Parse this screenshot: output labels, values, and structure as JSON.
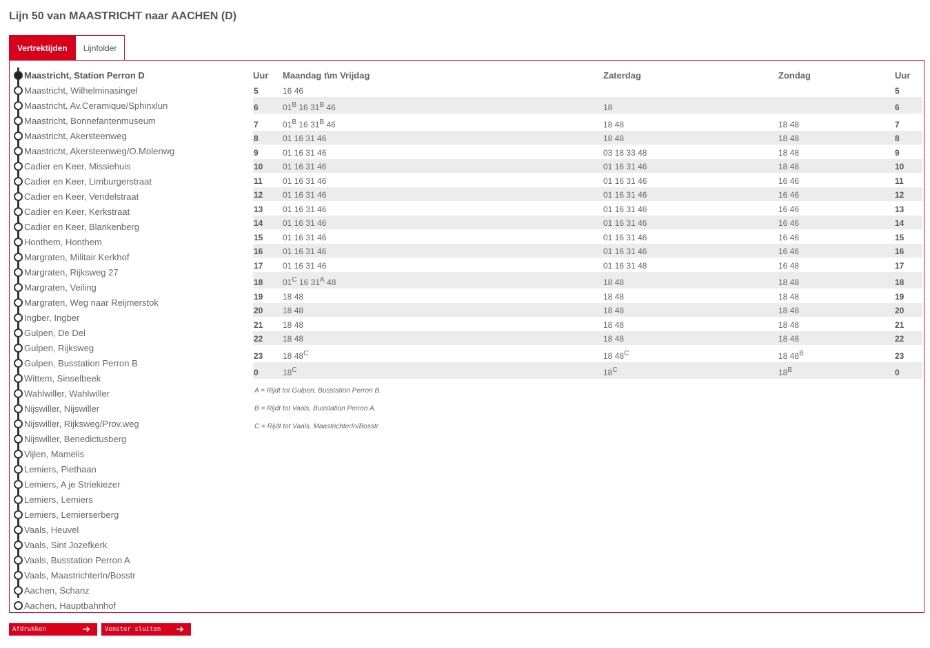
{
  "page": {
    "title": "Lijn 50 van MAASTRICHT naar AACHEN (D)"
  },
  "tabs": [
    {
      "label": "Vertrektijden",
      "active": true
    },
    {
      "label": "Lijnfolder",
      "active": false
    }
  ],
  "colors": {
    "accent": "#d9001b",
    "border": "#c8102e",
    "row_alt": "#ececec",
    "line": "#333333"
  },
  "stops": [
    "Maastricht, Station Perron D",
    "Maastricht, Wilhelminasingel",
    "Maastricht, Av.Ceramique/Sphinxlun",
    "Maastricht, Bonnefantenmuseum",
    "Maastricht, Akersteenweg",
    "Maastricht, Akersteenweg/O.Molenwg",
    "Cadier en Keer, Missiehuis",
    "Cadier en Keer, Limburgerstraat",
    "Cadier en Keer, Vendelstraat",
    "Cadier en Keer, Kerkstraat",
    "Cadier en Keer, Blankenberg",
    "Honthem, Honthem",
    "Margraten, Militair Kerkhof",
    "Margraten, Rijksweg 27",
    "Margraten, Veiling",
    "Margraten, Weg naar Reijmerstok",
    "Ingber, Ingber",
    "Gulpen, De Del",
    "Gulpen, Rijksweg",
    "Gulpen, Busstation Perron B",
    "Wittem, Sinselbeek",
    "Wahlwiller, Wahlwiller",
    "Nijswiller, Nijswiller",
    "Nijswiller, Rijksweg/Prov.weg",
    "Nijswiller, Benedictusberg",
    "Vijlen, Mamelis",
    "Lemiers, Piethaan",
    "Lemiers, A je Striekiezer",
    "Lemiers, Lemiers",
    "Lemiers, Lemierserberg",
    "Vaals, Heuvel",
    "Vaals, Sint Jozefkerk",
    "Vaals, Busstation Perron A",
    "Vaals, MaastrichterIn/Bosstr",
    "Aachen, Schanz",
    "Aachen, Hauptbahnhof"
  ],
  "timetable": {
    "headers": {
      "hour": "Uur",
      "weekday": "Maandag t\\m Vrijdag",
      "saturday": "Zaterdag",
      "sunday": "Zondag",
      "hour_right": "Uur"
    },
    "rows": [
      {
        "hour": "5",
        "weekday": [
          [
            "16",
            ""
          ],
          [
            "46",
            ""
          ]
        ],
        "saturday": [],
        "sunday": [],
        "tall": false
      },
      {
        "hour": "6",
        "weekday": [
          [
            "01",
            "B"
          ],
          [
            "16",
            ""
          ],
          [
            "31",
            "B"
          ],
          [
            "46",
            ""
          ]
        ],
        "saturday": [
          [
            "18",
            ""
          ]
        ],
        "sunday": [],
        "tall": true
      },
      {
        "hour": "7",
        "weekday": [
          [
            "01",
            "B"
          ],
          [
            "16",
            ""
          ],
          [
            "31",
            "B"
          ],
          [
            "46",
            ""
          ]
        ],
        "saturday": [
          [
            "18",
            ""
          ],
          [
            "48",
            ""
          ]
        ],
        "sunday": [
          [
            "18",
            ""
          ],
          [
            "48",
            ""
          ]
        ],
        "tall": true
      },
      {
        "hour": "8",
        "weekday": [
          [
            "01",
            ""
          ],
          [
            "16",
            ""
          ],
          [
            "31",
            ""
          ],
          [
            "46",
            ""
          ]
        ],
        "saturday": [
          [
            "18",
            ""
          ],
          [
            "48",
            ""
          ]
        ],
        "sunday": [
          [
            "18",
            ""
          ],
          [
            "48",
            ""
          ]
        ],
        "tall": false
      },
      {
        "hour": "9",
        "weekday": [
          [
            "01",
            ""
          ],
          [
            "16",
            ""
          ],
          [
            "31",
            ""
          ],
          [
            "46",
            ""
          ]
        ],
        "saturday": [
          [
            "03",
            ""
          ],
          [
            "18",
            ""
          ],
          [
            "33",
            ""
          ],
          [
            "48",
            ""
          ]
        ],
        "sunday": [
          [
            "18",
            ""
          ],
          [
            "48",
            ""
          ]
        ],
        "tall": false
      },
      {
        "hour": "10",
        "weekday": [
          [
            "01",
            ""
          ],
          [
            "16",
            ""
          ],
          [
            "31",
            ""
          ],
          [
            "46",
            ""
          ]
        ],
        "saturday": [
          [
            "01",
            ""
          ],
          [
            "16",
            ""
          ],
          [
            "31",
            ""
          ],
          [
            "46",
            ""
          ]
        ],
        "sunday": [
          [
            "18",
            ""
          ],
          [
            "48",
            ""
          ]
        ],
        "tall": false
      },
      {
        "hour": "11",
        "weekday": [
          [
            "01",
            ""
          ],
          [
            "16",
            ""
          ],
          [
            "31",
            ""
          ],
          [
            "46",
            ""
          ]
        ],
        "saturday": [
          [
            "01",
            ""
          ],
          [
            "16",
            ""
          ],
          [
            "31",
            ""
          ],
          [
            "46",
            ""
          ]
        ],
        "sunday": [
          [
            "16",
            ""
          ],
          [
            "46",
            ""
          ]
        ],
        "tall": false
      },
      {
        "hour": "12",
        "weekday": [
          [
            "01",
            ""
          ],
          [
            "16",
            ""
          ],
          [
            "31",
            ""
          ],
          [
            "46",
            ""
          ]
        ],
        "saturday": [
          [
            "01",
            ""
          ],
          [
            "16",
            ""
          ],
          [
            "31",
            ""
          ],
          [
            "46",
            ""
          ]
        ],
        "sunday": [
          [
            "16",
            ""
          ],
          [
            "46",
            ""
          ]
        ],
        "tall": false
      },
      {
        "hour": "13",
        "weekday": [
          [
            "01",
            ""
          ],
          [
            "16",
            ""
          ],
          [
            "31",
            ""
          ],
          [
            "46",
            ""
          ]
        ],
        "saturday": [
          [
            "01",
            ""
          ],
          [
            "16",
            ""
          ],
          [
            "31",
            ""
          ],
          [
            "46",
            ""
          ]
        ],
        "sunday": [
          [
            "16",
            ""
          ],
          [
            "46",
            ""
          ]
        ],
        "tall": false
      },
      {
        "hour": "14",
        "weekday": [
          [
            "01",
            ""
          ],
          [
            "16",
            ""
          ],
          [
            "31",
            ""
          ],
          [
            "46",
            ""
          ]
        ],
        "saturday": [
          [
            "01",
            ""
          ],
          [
            "16",
            ""
          ],
          [
            "31",
            ""
          ],
          [
            "46",
            ""
          ]
        ],
        "sunday": [
          [
            "16",
            ""
          ],
          [
            "46",
            ""
          ]
        ],
        "tall": false
      },
      {
        "hour": "15",
        "weekday": [
          [
            "01",
            ""
          ],
          [
            "16",
            ""
          ],
          [
            "31",
            ""
          ],
          [
            "46",
            ""
          ]
        ],
        "saturday": [
          [
            "01",
            ""
          ],
          [
            "16",
            ""
          ],
          [
            "31",
            ""
          ],
          [
            "46",
            ""
          ]
        ],
        "sunday": [
          [
            "16",
            ""
          ],
          [
            "46",
            ""
          ]
        ],
        "tall": false
      },
      {
        "hour": "16",
        "weekday": [
          [
            "01",
            ""
          ],
          [
            "16",
            ""
          ],
          [
            "31",
            ""
          ],
          [
            "46",
            ""
          ]
        ],
        "saturday": [
          [
            "01",
            ""
          ],
          [
            "16",
            ""
          ],
          [
            "31",
            ""
          ],
          [
            "46",
            ""
          ]
        ],
        "sunday": [
          [
            "16",
            ""
          ],
          [
            "46",
            ""
          ]
        ],
        "tall": false
      },
      {
        "hour": "17",
        "weekday": [
          [
            "01",
            ""
          ],
          [
            "16",
            ""
          ],
          [
            "31",
            ""
          ],
          [
            "46",
            ""
          ]
        ],
        "saturday": [
          [
            "01",
            ""
          ],
          [
            "16",
            ""
          ],
          [
            "31",
            ""
          ],
          [
            "48",
            ""
          ]
        ],
        "sunday": [
          [
            "16",
            ""
          ],
          [
            "48",
            ""
          ]
        ],
        "tall": false
      },
      {
        "hour": "18",
        "weekday": [
          [
            "01",
            "C"
          ],
          [
            "16",
            ""
          ],
          [
            "31",
            "A"
          ],
          [
            "48",
            ""
          ]
        ],
        "saturday": [
          [
            "18",
            ""
          ],
          [
            "48",
            ""
          ]
        ],
        "sunday": [
          [
            "18",
            ""
          ],
          [
            "48",
            ""
          ]
        ],
        "tall": true
      },
      {
        "hour": "19",
        "weekday": [
          [
            "18",
            ""
          ],
          [
            "48",
            ""
          ]
        ],
        "saturday": [
          [
            "18",
            ""
          ],
          [
            "48",
            ""
          ]
        ],
        "sunday": [
          [
            "18",
            ""
          ],
          [
            "48",
            ""
          ]
        ],
        "tall": false
      },
      {
        "hour": "20",
        "weekday": [
          [
            "18",
            ""
          ],
          [
            "48",
            ""
          ]
        ],
        "saturday": [
          [
            "18",
            ""
          ],
          [
            "48",
            ""
          ]
        ],
        "sunday": [
          [
            "18",
            ""
          ],
          [
            "48",
            ""
          ]
        ],
        "tall": false
      },
      {
        "hour": "21",
        "weekday": [
          [
            "18",
            ""
          ],
          [
            "48",
            ""
          ]
        ],
        "saturday": [
          [
            "18",
            ""
          ],
          [
            "48",
            ""
          ]
        ],
        "sunday": [
          [
            "18",
            ""
          ],
          [
            "48",
            ""
          ]
        ],
        "tall": false
      },
      {
        "hour": "22",
        "weekday": [
          [
            "18",
            ""
          ],
          [
            "48",
            ""
          ]
        ],
        "saturday": [
          [
            "18",
            ""
          ],
          [
            "48",
            ""
          ]
        ],
        "sunday": [
          [
            "18",
            ""
          ],
          [
            "48",
            ""
          ]
        ],
        "tall": false
      },
      {
        "hour": "23",
        "weekday": [
          [
            "18",
            ""
          ],
          [
            "48",
            "C"
          ]
        ],
        "saturday": [
          [
            "18",
            ""
          ],
          [
            "48",
            "C"
          ]
        ],
        "sunday": [
          [
            "18",
            ""
          ],
          [
            "48",
            "B"
          ]
        ],
        "tall": true
      },
      {
        "hour": "0",
        "weekday": [
          [
            "18",
            "C"
          ]
        ],
        "saturday": [
          [
            "18",
            "C"
          ]
        ],
        "sunday": [
          [
            "18",
            "B"
          ]
        ],
        "tall": true
      }
    ]
  },
  "notes": [
    "A = Rijdt tot Gulpen, Busstation Perron B.",
    "B = Rijdt tot Vaals, Busstation Perron A.",
    "C = Rijdt tot Vaals, MaastrichterIn/Bosstr."
  ],
  "buttons": {
    "print_label": "Afdrukken",
    "close_label": "Venster sluiten",
    "arrow_icon": "arrow-right-icon"
  }
}
